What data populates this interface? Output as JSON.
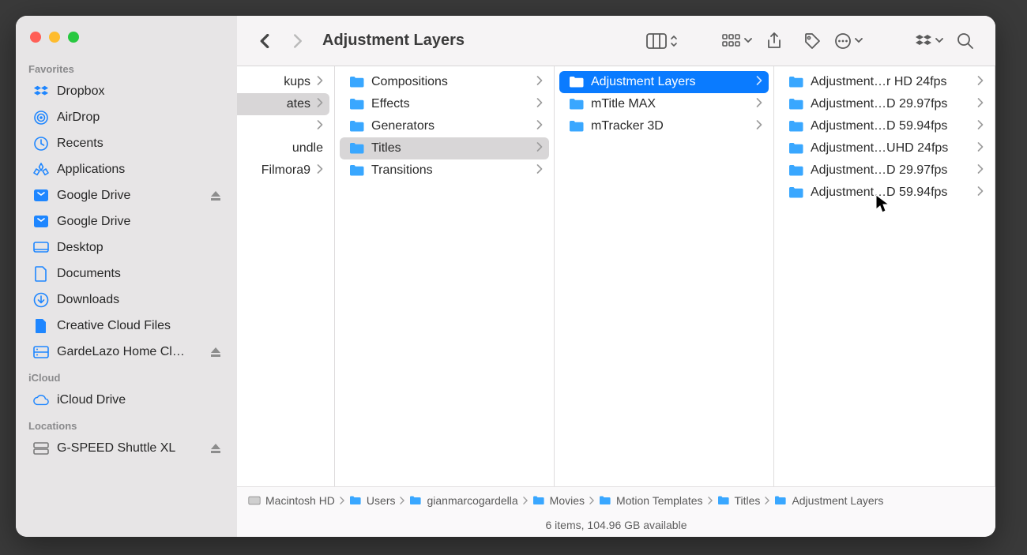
{
  "window": {
    "title": "Adjustment Layers"
  },
  "sidebar": {
    "sections": [
      {
        "label": "Favorites",
        "items": [
          {
            "icon": "dropbox",
            "label": "Dropbox"
          },
          {
            "icon": "airdrop",
            "label": "AirDrop"
          },
          {
            "icon": "clock",
            "label": "Recents"
          },
          {
            "icon": "apps",
            "label": "Applications"
          },
          {
            "icon": "gdrive",
            "label": "Google Drive",
            "eject": true
          },
          {
            "icon": "gdrive",
            "label": "Google Drive"
          },
          {
            "icon": "desktop",
            "label": "Desktop"
          },
          {
            "icon": "doc",
            "label": "Documents"
          },
          {
            "icon": "download",
            "label": "Downloads"
          },
          {
            "icon": "ccf",
            "label": "Creative Cloud Files"
          },
          {
            "icon": "server",
            "label": "GardeLazo Home Cl…",
            "eject": true
          }
        ]
      },
      {
        "label": "iCloud",
        "items": [
          {
            "icon": "cloud",
            "label": "iCloud Drive"
          }
        ]
      },
      {
        "label": "Locations",
        "items": [
          {
            "icon": "disk",
            "label": "G-SPEED Shuttle XL",
            "eject": true
          }
        ]
      }
    ]
  },
  "columns": [
    {
      "items": [
        {
          "label": "kups",
          "chev": true
        },
        {
          "label": "ates",
          "chev": true,
          "sel": "gray"
        },
        {
          "label": "",
          "chev": true
        },
        {
          "label": "undle"
        },
        {
          "label": "Filmora9",
          "chev": true
        }
      ]
    },
    {
      "items": [
        {
          "label": "Compositions",
          "chev": true,
          "folder": true
        },
        {
          "label": "Effects",
          "chev": true,
          "folder": true
        },
        {
          "label": "Generators",
          "chev": true,
          "folder": true
        },
        {
          "label": "Titles",
          "chev": true,
          "folder": true,
          "sel": "gray"
        },
        {
          "label": "Transitions",
          "chev": true,
          "folder": true
        }
      ]
    },
    {
      "items": [
        {
          "label": "Adjustment Layers",
          "chev": true,
          "folder": true,
          "sel": "blue"
        },
        {
          "label": "mTitle MAX",
          "chev": true,
          "folder": true
        },
        {
          "label": "mTracker 3D",
          "chev": true,
          "folder": true
        }
      ]
    },
    {
      "items": [
        {
          "label": "Adjustment…r HD 24fps",
          "chev": true,
          "folder": true
        },
        {
          "label": "Adjustment…D 29.97fps",
          "chev": true,
          "folder": true
        },
        {
          "label": "Adjustment…D 59.94fps",
          "chev": true,
          "folder": true
        },
        {
          "label": "Adjustment…UHD 24fps",
          "chev": true,
          "folder": true
        },
        {
          "label": "Adjustment…D 29.97fps",
          "chev": true,
          "folder": true
        },
        {
          "label": "Adjustment…D 59.94fps",
          "chev": true,
          "folder": true
        }
      ]
    }
  ],
  "path": [
    "Macintosh HD",
    "Users",
    "gianmarcogardella",
    "Movies",
    "Motion Templates",
    "Titles",
    "Adjustment Layers"
  ],
  "status": "6 items, 104.96 GB available"
}
